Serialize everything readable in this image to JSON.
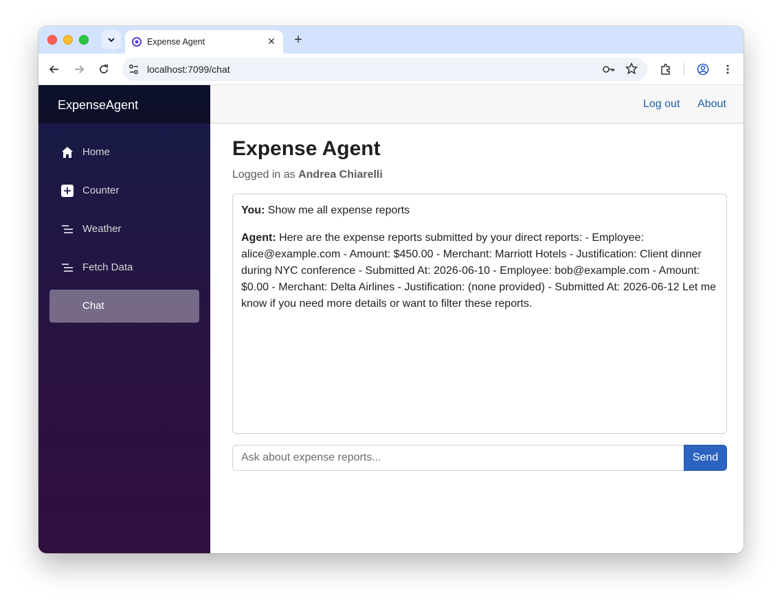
{
  "browser": {
    "tab_title": "Expense Agent",
    "url": "localhost:7099/chat",
    "icons": [
      "tab-search-icon",
      "close-icon",
      "plus-icon",
      "back-icon",
      "forward-icon",
      "reload-icon",
      "site-settings-icon",
      "key-icon",
      "star-icon",
      "extensions-icon",
      "profile-icon",
      "more-icon"
    ]
  },
  "sidebar": {
    "brand": "ExpenseAgent",
    "items": [
      {
        "label": "Home",
        "icon": "home-icon",
        "active": false
      },
      {
        "label": "Counter",
        "icon": "plus-square-icon",
        "active": false
      },
      {
        "label": "Weather",
        "icon": "list-icon",
        "active": false
      },
      {
        "label": "Fetch Data",
        "icon": "list-icon",
        "active": false
      },
      {
        "label": "Chat",
        "icon": "",
        "active": true
      }
    ]
  },
  "topbar": {
    "logout": "Log out",
    "about": "About"
  },
  "page": {
    "title": "Expense Agent",
    "logged_prefix": "Logged in as",
    "user_name": "Andrea Chiarelli"
  },
  "chat": {
    "messages": [
      {
        "speaker": "You:",
        "text": " Show me all expense reports"
      },
      {
        "speaker": "Agent:",
        "text": " Here are the expense reports submitted by your direct reports: - Employee: alice@example.com - Amount: $450.00 - Merchant: Marriott Hotels - Justification: Client dinner during NYC conference - Submitted At: 2026-06-10 - Employee: bob@example.com - Amount: $0.00 - Merchant: Delta Airlines - Justification: (none provided) - Submitted At: 2026-06-12 Let me know if you need more details or want to filter these reports."
      }
    ],
    "input_placeholder": "Ask about expense reports...",
    "input_value": "",
    "send_label": "Send"
  }
}
